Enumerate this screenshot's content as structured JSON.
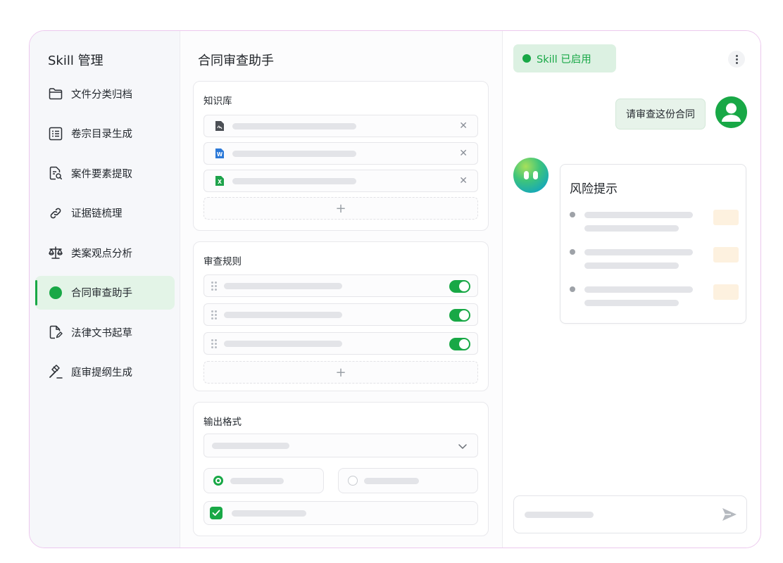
{
  "sidebar": {
    "title": "Skill 管理",
    "items": [
      {
        "label": "文件分类归档",
        "icon": "folder-icon"
      },
      {
        "label": "卷宗目录生成",
        "icon": "list-icon"
      },
      {
        "label": "案件要素提取",
        "icon": "document-search-icon"
      },
      {
        "label": "证据链梳理",
        "icon": "link-icon"
      },
      {
        "label": "类案观点分析",
        "icon": "scale-icon"
      },
      {
        "label": "合同审查助手",
        "icon": "green-dot-icon",
        "active": true
      },
      {
        "label": "法律文书起草",
        "icon": "document-edit-icon"
      },
      {
        "label": "庭审提纲生成",
        "icon": "gavel-icon"
      }
    ]
  },
  "main": {
    "title": "合同审查助手",
    "knowledge": {
      "title": "知识库",
      "files": [
        {
          "type": "pdf",
          "icon": "pdf-file-icon"
        },
        {
          "type": "word",
          "icon": "word-file-icon",
          "glyph": "W"
        },
        {
          "type": "excel",
          "icon": "excel-file-icon",
          "glyph": "X"
        }
      ],
      "add_label": "+"
    },
    "rules": {
      "title": "审查规则",
      "items": [
        {
          "enabled": true
        },
        {
          "enabled": true
        },
        {
          "enabled": true
        }
      ],
      "add_label": "+"
    },
    "output": {
      "title": "输出格式",
      "radio_selected": 0,
      "checkbox_checked": true
    }
  },
  "chat": {
    "status": "Skill 已启用",
    "user_message": "请审查这份合同",
    "risk_title": "风险提示",
    "risk_items": 3
  },
  "colors": {
    "accent": "#18a846",
    "accent_light": "#e3f4e7",
    "tag": "#fdf1df"
  }
}
